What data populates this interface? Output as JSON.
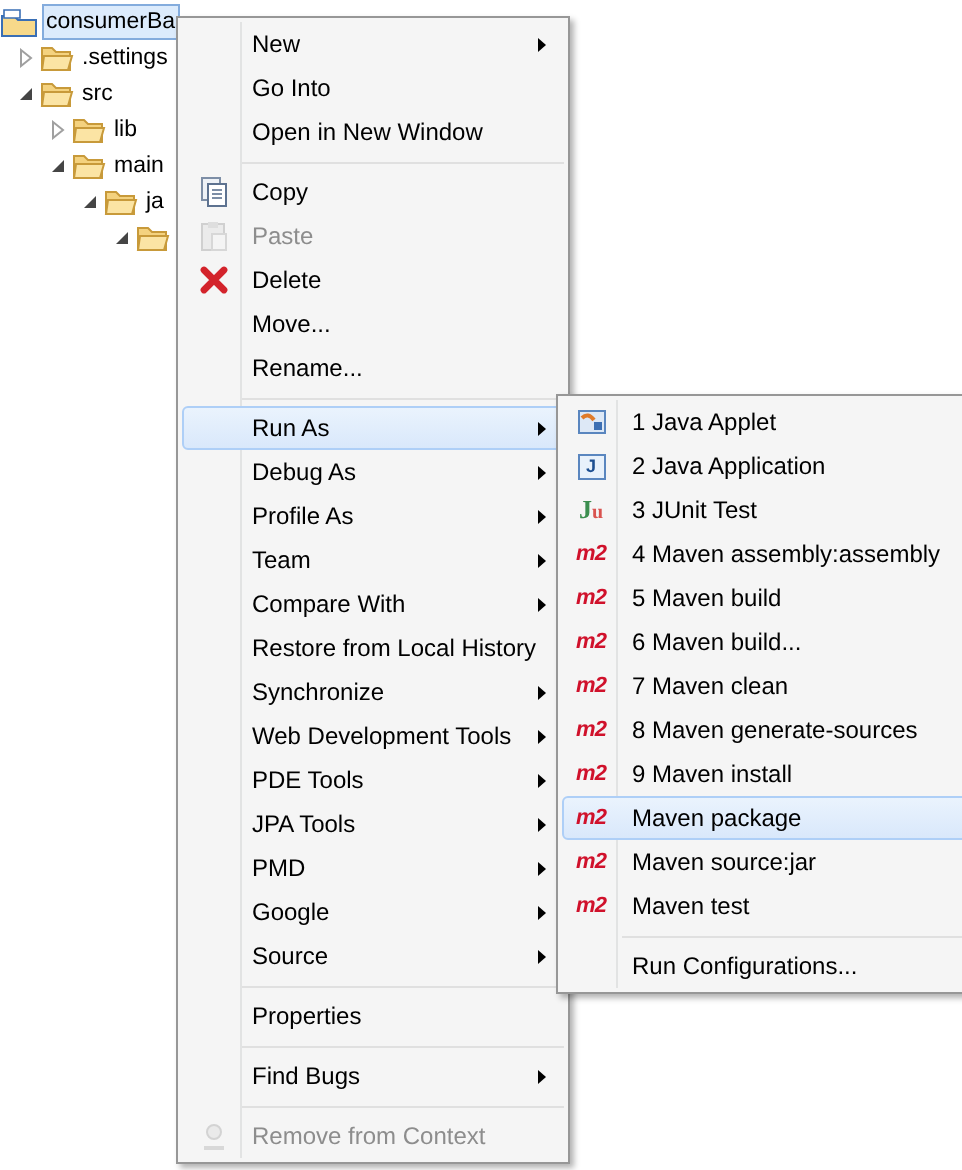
{
  "tree": [
    {
      "label": "consumerBa",
      "selected": true,
      "children": [
        {
          "label": ".settings",
          "selected": false,
          "expanded": false
        },
        {
          "label": "src",
          "selected": false,
          "expanded": true,
          "children": [
            {
              "label": "lib",
              "selected": false,
              "expanded": false
            },
            {
              "label": "main",
              "selected": false,
              "expanded": true,
              "children": [
                {
                  "label": "ja",
                  "selected": false,
                  "expanded": true,
                  "children": [
                    {
                      "expanded": true
                    }
                  ]
                }
              ]
            }
          ]
        }
      ]
    }
  ],
  "context_menu": [
    {
      "kind": "plain",
      "label": "New",
      "submenu": true,
      "disabled": false,
      "selected": false
    },
    {
      "kind": "plain",
      "label": "Go Into",
      "submenu": false,
      "disabled": false,
      "selected": false
    },
    {
      "kind": "plain",
      "label": "Open in New Window",
      "submenu": false,
      "disabled": false,
      "selected": false
    },
    {
      "kind": "separator"
    },
    {
      "kind": "copy",
      "label": "Copy",
      "submenu": false,
      "disabled": false,
      "selected": false
    },
    {
      "kind": "paste",
      "label": "Paste",
      "submenu": false,
      "disabled": true,
      "selected": false
    },
    {
      "kind": "delete",
      "label": "Delete",
      "submenu": false,
      "disabled": false,
      "selected": false
    },
    {
      "kind": "plain",
      "label": "Move...",
      "submenu": false,
      "disabled": false,
      "selected": false
    },
    {
      "kind": "plain",
      "label": "Rename...",
      "submenu": false,
      "disabled": false,
      "selected": false
    },
    {
      "kind": "separator"
    },
    {
      "kind": "plain",
      "label": "Run As",
      "submenu": true,
      "disabled": false,
      "selected": true
    },
    {
      "kind": "plain",
      "label": "Debug As",
      "submenu": true,
      "disabled": false,
      "selected": false
    },
    {
      "kind": "plain",
      "label": "Profile As",
      "submenu": true,
      "disabled": false,
      "selected": false
    },
    {
      "kind": "plain",
      "label": "Team",
      "submenu": true,
      "disabled": false,
      "selected": false
    },
    {
      "kind": "plain",
      "label": "Compare With",
      "submenu": true,
      "disabled": false,
      "selected": false
    },
    {
      "kind": "plain",
      "label": "Restore from Local History",
      "submenu": false,
      "disabled": false,
      "selected": false
    },
    {
      "kind": "plain",
      "label": "Synchronize",
      "submenu": true,
      "disabled": false,
      "selected": false
    },
    {
      "kind": "plain",
      "label": "Web Development Tools",
      "submenu": true,
      "disabled": false,
      "selected": false
    },
    {
      "kind": "plain",
      "label": "PDE Tools",
      "submenu": true,
      "disabled": false,
      "selected": false
    },
    {
      "kind": "plain",
      "label": "JPA Tools",
      "submenu": true,
      "disabled": false,
      "selected": false
    },
    {
      "kind": "plain",
      "label": "PMD",
      "submenu": true,
      "disabled": false,
      "selected": false
    },
    {
      "kind": "plain",
      "label": "Google",
      "submenu": true,
      "disabled": false,
      "selected": false
    },
    {
      "kind": "plain",
      "label": "Source",
      "submenu": true,
      "disabled": false,
      "selected": false
    },
    {
      "kind": "separator"
    },
    {
      "kind": "plain",
      "label": "Properties",
      "submenu": false,
      "disabled": false,
      "selected": false
    },
    {
      "kind": "separator"
    },
    {
      "kind": "plain",
      "label": "Find Bugs",
      "submenu": true,
      "disabled": false,
      "selected": false
    },
    {
      "kind": "separator"
    },
    {
      "kind": "remove",
      "label": "Remove from Context",
      "submenu": false,
      "disabled": true,
      "selected": false
    }
  ],
  "run_as_submenu": [
    {
      "kind": "applet",
      "label": "1 Java Applet",
      "selected": false
    },
    {
      "kind": "application",
      "badge": "J",
      "label": "2 Java Application",
      "selected": false
    },
    {
      "kind": "junit",
      "badge": "Ju",
      "label": "3 JUnit Test",
      "selected": false
    },
    {
      "kind": "maven",
      "badge": "m2",
      "label": "4 Maven assembly:assembly",
      "selected": false
    },
    {
      "kind": "maven",
      "badge": "m2",
      "label": "5 Maven build",
      "selected": false
    },
    {
      "kind": "maven",
      "badge": "m2",
      "label": "6 Maven build...",
      "selected": false
    },
    {
      "kind": "maven",
      "badge": "m2",
      "label": "7 Maven clean",
      "selected": false
    },
    {
      "kind": "maven",
      "badge": "m2",
      "label": "8 Maven generate-sources",
      "selected": false
    },
    {
      "kind": "maven",
      "badge": "m2",
      "label": "9 Maven install",
      "selected": false
    },
    {
      "kind": "maven",
      "badge": "m2",
      "label": "Maven package",
      "selected": true
    },
    {
      "kind": "maven",
      "badge": "m2",
      "label": "Maven source:jar",
      "selected": false
    },
    {
      "kind": "maven",
      "badge": "m2",
      "label": "Maven test",
      "selected": false
    },
    {
      "kind": "separator"
    },
    {
      "kind": "plain",
      "label": "Run Configurations...",
      "selected": false
    }
  ]
}
